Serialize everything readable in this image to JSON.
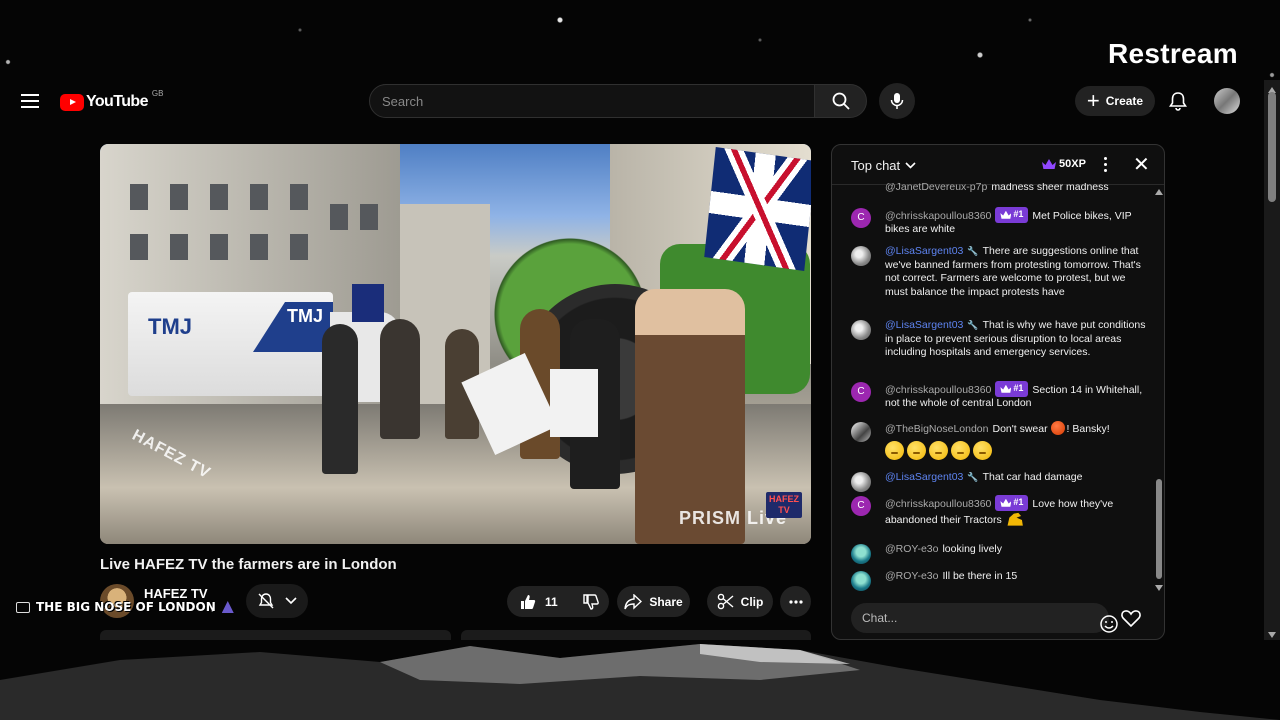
{
  "overlay_brand": "Restream",
  "youtube": {
    "logo_text": "YouTube",
    "region": "GB",
    "search": {
      "placeholder": "Search"
    },
    "create_label": "Create",
    "icons": [
      "menu-icon",
      "search-icon",
      "mic-icon",
      "plus-icon",
      "bell-icon",
      "account-avatar"
    ]
  },
  "video": {
    "watermark_left": "HAFEZ TV",
    "watermark_right": "PRISM Live",
    "corner_logo": "HAFEZ TV",
    "van_text": "TMJ",
    "title": "Live HAFEZ TV the farmers are in London",
    "channel": {
      "name": "HAFEZ TV",
      "subs_fragment": "rs"
    },
    "overlay_banner": "THE BIG NOSE OF LONDON",
    "likes": "11",
    "share_label": "Share",
    "clip_label": "Clip"
  },
  "chat": {
    "mode_label": "Top chat",
    "xp": "50XP",
    "input_placeholder": "Chat...",
    "messages": [
      {
        "author": "@JanetDevereux-p7p",
        "text": "madness sheer madness",
        "avatar": "none",
        "mod": false,
        "badge": ""
      },
      {
        "author": "@chrisskapoullou8360",
        "text": "Met Police bikes, VIP bikes are white",
        "avatar": "C",
        "mod": false,
        "badge": "#1"
      },
      {
        "author": "@LisaSargent03",
        "text": "There are suggestions online that we've banned farmers from protesting tomorrow. That's not correct. Farmers are welcome to protest, but we must balance the impact protests have",
        "avatar": "grey",
        "mod": true,
        "badge": ""
      },
      {
        "author": "@LisaSargent03",
        "text": "That is why we have put conditions in place to prevent serious disruption to local areas including hospitals and emergency services.",
        "avatar": "grey",
        "mod": true,
        "badge": ""
      },
      {
        "author": "@chrisskapoullou8360",
        "text": "Section 14 in Whitehall, not the whole of central London",
        "avatar": "C",
        "mod": false,
        "badge": "#1"
      },
      {
        "author": "@TheBigNoseLondon",
        "text_before": "Don't swear",
        "text_after": "! Bansky!",
        "avatar": "bw",
        "mod": false,
        "badge": ""
      },
      {
        "author": "@LisaSargent03",
        "text": "That car had damage",
        "avatar": "grey",
        "mod": true,
        "badge": ""
      },
      {
        "author": "@chrisskapoullou8360",
        "text": "Love how they've abandoned their Tractors",
        "avatar": "C",
        "mod": false,
        "badge": "#1"
      },
      {
        "author": "@ROY-e3o",
        "text": "looking lively",
        "avatar": "teal",
        "mod": false,
        "badge": ""
      },
      {
        "author": "@ROY-e3o",
        "text": "Ill be there in 15",
        "avatar": "teal",
        "mod": false,
        "badge": ""
      }
    ]
  }
}
